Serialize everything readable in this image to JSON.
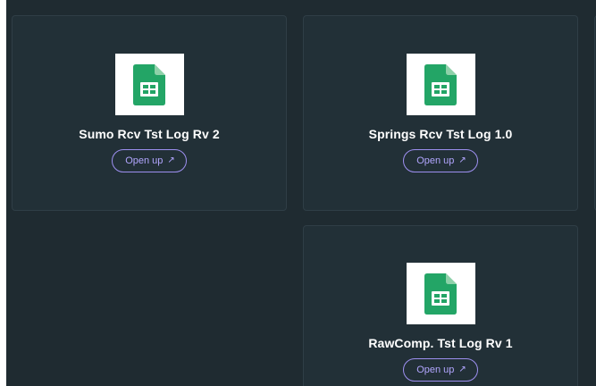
{
  "cards": [
    {
      "title": "Sumo Rcv Tst Log Rv 2",
      "button_label": "Open up",
      "icon": "google-sheets-icon"
    },
    {
      "title": "Springs Rcv Tst Log 1.0",
      "button_label": "Open up",
      "icon": "google-sheets-icon"
    },
    {
      "title": "RawComp. Tst Log Rv 1",
      "button_label": "Open up",
      "icon": "google-sheets-icon"
    }
  ],
  "button_arrow": "↗",
  "colors": {
    "background": "#1f2b31",
    "card": "#223037",
    "accent": "#9d8ff0",
    "sheets_green": "#23a566"
  }
}
